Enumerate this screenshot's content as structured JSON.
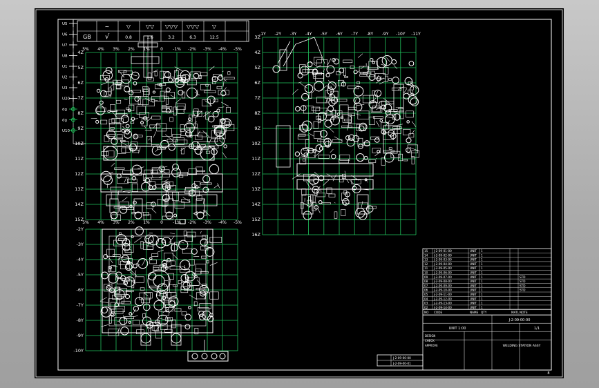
{
  "app": {
    "background_color": "#a9a9a9",
    "sheet_color": "#000000"
  },
  "drawing": {
    "colors": {
      "grid": "#22c55e",
      "line": "#ffffff",
      "frame": "#ffffff"
    },
    "left_grid": {
      "x_labels": [
        "5%",
        "4%",
        "3%",
        "2%",
        "1%",
        "0",
        "-1%",
        "-2%",
        "-3%",
        "-4%",
        "-5%"
      ],
      "y_labels": [
        "4Z",
        "5Z",
        "6Z",
        "7Z",
        "8Z",
        "9Z",
        "10Z",
        "11Z",
        "12Z",
        "13Z",
        "14Z",
        "15Z"
      ]
    },
    "right_grid": {
      "x_labels": [
        "-1Y",
        "-2Y",
        "-3Y",
        "-4Y",
        "-5Y",
        "-6Y",
        "-7Y",
        "-8Y",
        "-9Y",
        "-10Y",
        "-11Y"
      ],
      "y_labels": [
        "3Z",
        "4Z",
        "5Z",
        "6Z",
        "7Z",
        "8Z",
        "9Z",
        "10Z",
        "11Z",
        "12Z",
        "13Z",
        "14Z",
        "15Z",
        "16Z"
      ]
    },
    "plan_grid": {
      "y_labels": [
        "-2Y",
        "-3Y",
        "-4Y",
        "-5Y",
        "-6Y",
        "-7Y",
        "-8Y",
        "-9Y",
        "-10Y"
      ]
    },
    "symbol_table": {
      "side_labels": [
        "U5",
        "U6",
        "U7",
        "U8",
        "U1",
        "U2",
        "U3",
        "U20",
        "dg",
        "dg",
        "U10"
      ],
      "std_label": "GB",
      "header_symbols": [
        "~",
        "▽",
        "▽▽",
        "▽▽▽",
        "▽▽▽",
        "▽"
      ],
      "value_symbols": [
        "√",
        "0.8",
        "1.6",
        "3.2",
        "6.3",
        "12.5"
      ]
    },
    "parts_list": {
      "rows": [
        {
          "no": "15",
          "code": "J-2-09-01-00",
          "name": "UNIT",
          "qty": "1",
          "note": ""
        },
        {
          "no": "14",
          "code": "J-2-09-02-00",
          "name": "UNIT",
          "qty": "1",
          "note": ""
        },
        {
          "no": "13",
          "code": "J-2-09-03-00",
          "name": "UNIT",
          "qty": "1",
          "note": ""
        },
        {
          "no": "12",
          "code": "J-2-09-04-00",
          "name": "UNIT",
          "qty": "1",
          "note": ""
        },
        {
          "no": "11",
          "code": "J-2-09-05-00",
          "name": "UNIT",
          "qty": "1",
          "note": ""
        },
        {
          "no": "10",
          "code": "J-2-09-06-00",
          "name": "UNIT",
          "qty": "1",
          "note": ""
        },
        {
          "no": "09",
          "code": "J-2-09-07-00",
          "name": "UNIT",
          "qty": "1",
          "note": "STD"
        },
        {
          "no": "08",
          "code": "J-2-09-08-00",
          "name": "UNIT",
          "qty": "1",
          "note": "STD"
        },
        {
          "no": "07",
          "code": "J-2-09-09-00",
          "name": "UNIT",
          "qty": "1",
          "note": "STD"
        },
        {
          "no": "06",
          "code": "J-2-09-10-00",
          "name": "UNIT",
          "qty": "1",
          "note": "STD"
        },
        {
          "no": "05",
          "code": "J-2-09-11-00",
          "name": "UNIT",
          "qty": "1",
          "note": ""
        },
        {
          "no": "04",
          "code": "J-2-09-12-00",
          "name": "UNIT",
          "qty": "1",
          "note": ""
        },
        {
          "no": "03",
          "code": "J-2-09-13-00",
          "name": "UNIT",
          "qty": "1",
          "note": ""
        },
        {
          "no": "02",
          "code": "J-2-09-14-00",
          "name": "UNIT",
          "qty": "1",
          "note": ""
        }
      ],
      "header": [
        "NO",
        "CODE",
        "NAME",
        "QTY",
        "MATL",
        "NOTE"
      ]
    },
    "title_block": {
      "drawing_no": "J-2-09-00-00",
      "scale": "UNIT 1:00",
      "sheet": "1/1",
      "company": "WELDING STATION ASSY",
      "sign_rows": [
        "DESIGN",
        "CHECK",
        "APPROVE"
      ],
      "left_codes": [
        "J-2-09-00-00",
        "J-2-09-00-01"
      ]
    },
    "corner_mark": "8"
  }
}
